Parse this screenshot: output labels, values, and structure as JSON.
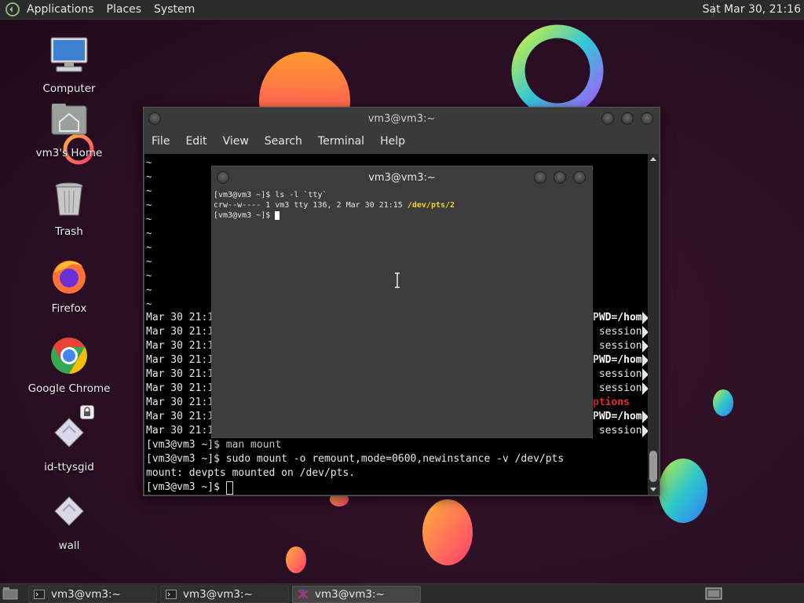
{
  "top_panel": {
    "menu_applications": "Applications",
    "menu_places": "Places",
    "menu_system": "System",
    "clock": "Sat Mar 30, 21:16"
  },
  "desktop_icons": [
    {
      "label": "Computer"
    },
    {
      "label": "vm3's Home"
    },
    {
      "label": "Trash"
    },
    {
      "label": "Firefox"
    },
    {
      "label": "Google Chrome"
    },
    {
      "label": "id-ttysgid"
    },
    {
      "label": "wall"
    }
  ],
  "back_terminal": {
    "title": "vm3@vm3:~",
    "menu": [
      "File",
      "Edit",
      "View",
      "Search",
      "Terminal",
      "Help"
    ],
    "tilde_rows": [
      "~",
      "~",
      "~",
      "~",
      "~",
      "~",
      "~",
      "~",
      "~",
      "~",
      "~"
    ],
    "log_rows": [
      {
        "left": "Mar 30 21:1",
        "right": "PWD=/hom",
        "right_color": "#ffffff",
        "bold": true
      },
      {
        "left": "Mar 30 21:1",
        "right": " session",
        "right_color": "#e8e8e8",
        "bold": false
      },
      {
        "left": "Mar 30 21:1",
        "right": " session",
        "right_color": "#e8e8e8",
        "bold": false
      },
      {
        "left": "Mar 30 21:1",
        "right": "PWD=/hom",
        "right_color": "#ffffff",
        "bold": true
      },
      {
        "left": "Mar 30 21:1",
        "right": " session",
        "right_color": "#e8e8e8",
        "bold": false
      },
      {
        "left": "Mar 30 21:1",
        "right": " session",
        "right_color": "#e8e8e8",
        "bold": false
      },
      {
        "left": "Mar 30 21:1",
        "right": "ptions",
        "right_color": "#e03030",
        "bold": true
      },
      {
        "left": "Mar 30 21:1",
        "right": "PWD=/hom",
        "right_color": "#ffffff",
        "bold": true
      },
      {
        "left": "Mar 30 21:1",
        "right": " session",
        "right_color": "#e8e8e8",
        "bold": false
      }
    ],
    "shell_lines": [
      "[vm3@vm3 ~]$ man mount",
      "[vm3@vm3 ~]$ sudo mount -o remount,mode=0600,newinstance -v /dev/pts",
      "mount: devpts mounted on /dev/pts."
    ],
    "prompt": "[vm3@vm3 ~]$ "
  },
  "front_terminal": {
    "title": "vm3@vm3:~",
    "line1": "[vm3@vm3 ~]$ ls -l `tty`",
    "line2_prefix": "crw--w---- 1 vm3 tty 136, 2 Mar 30 21:15 ",
    "line2_path": "/dev/pts/2",
    "line3": "[vm3@vm3 ~]$ "
  },
  "taskbar": [
    {
      "label": "vm3@vm3:~",
      "active": false
    },
    {
      "label": "vm3@vm3:~",
      "active": false
    },
    {
      "label": "vm3@vm3:~",
      "active": true
    }
  ],
  "colors": {
    "path_highlight": "#f5d327",
    "accent_red": "#e03030"
  }
}
